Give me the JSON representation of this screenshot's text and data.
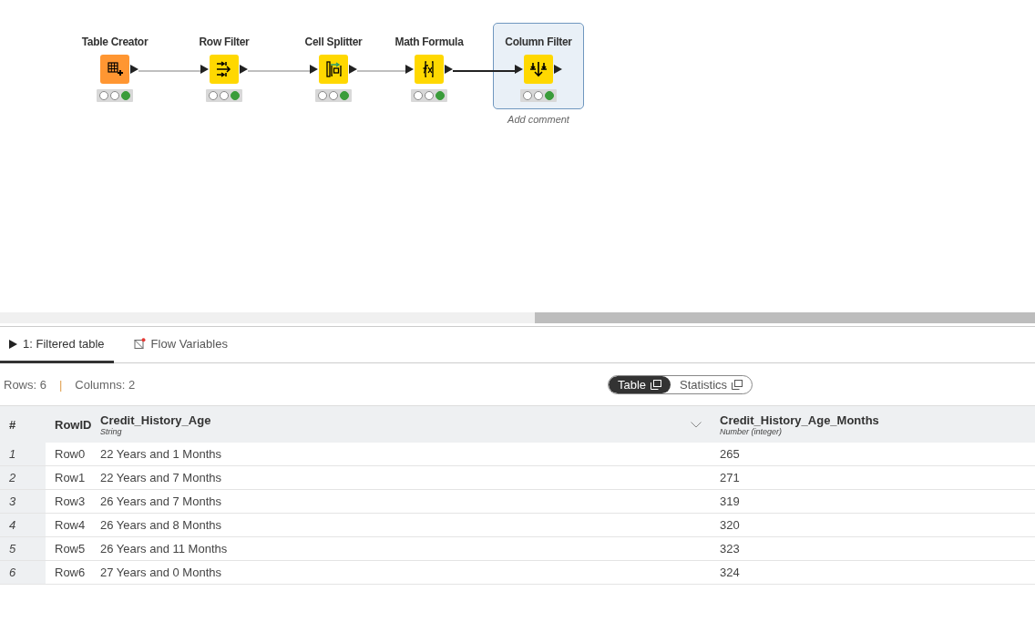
{
  "workflow": {
    "nodes": [
      {
        "name": "Table Creator",
        "kind": "creator",
        "color": "#ff9632",
        "executed": true,
        "selected": false
      },
      {
        "name": "Row Filter",
        "kind": "rowfilter",
        "color": "#ffd800",
        "executed": true,
        "selected": false
      },
      {
        "name": "Cell Splitter",
        "kind": "splitter",
        "color": "#ffd800",
        "executed": true,
        "selected": false
      },
      {
        "name": "Math Formula",
        "kind": "formula",
        "color": "#ffd800",
        "executed": true,
        "selected": false
      },
      {
        "name": "Column Filter",
        "kind": "colfilter",
        "color": "#ffd800",
        "executed": true,
        "selected": true,
        "comment": "Add comment"
      }
    ],
    "links": [
      {
        "selected": false
      },
      {
        "selected": false
      },
      {
        "selected": false
      },
      {
        "selected": true
      }
    ]
  },
  "output_panel": {
    "tabs": [
      {
        "label": "1: Filtered table",
        "kind": "port",
        "selected": true
      },
      {
        "label": "Flow Variables",
        "kind": "variables",
        "selected": false
      }
    ],
    "rows_count": "Rows: 6",
    "separator": "|",
    "columns_count": "Columns: 2",
    "view_toggle": [
      {
        "label": "Table",
        "selected": true
      },
      {
        "label": "Statistics",
        "selected": false
      }
    ],
    "table": {
      "columns": [
        {
          "name": "#"
        },
        {
          "name": "RowID"
        },
        {
          "name": "Credit_History_Age",
          "type": "String",
          "menu": true
        },
        {
          "name": "Credit_History_Age_Months",
          "type": "Number (integer)",
          "menu": false
        }
      ],
      "rows": [
        [
          "1",
          "Row0",
          "22 Years and 1 Months",
          "265"
        ],
        [
          "2",
          "Row1",
          "22 Years and 7 Months",
          "271"
        ],
        [
          "3",
          "Row3",
          "26 Years and 7 Months",
          "319"
        ],
        [
          "4",
          "Row4",
          "26 Years and 8 Months",
          "320"
        ],
        [
          "5",
          "Row5",
          "26 Years and 11 Months",
          "323"
        ],
        [
          "6",
          "Row6",
          "27 Years and 0 Months",
          "324"
        ]
      ]
    }
  }
}
